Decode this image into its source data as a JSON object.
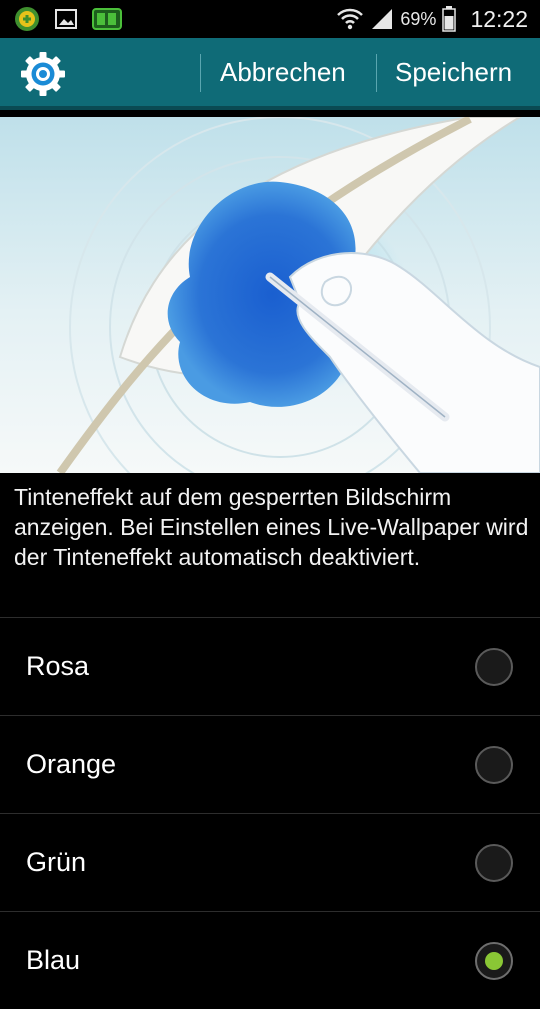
{
  "status_bar": {
    "battery_percent": "69%",
    "time": "12:22",
    "icons": [
      "app-notification-icon",
      "image-notification-icon",
      "game-notification-icon",
      "wifi-icon",
      "signal-icon",
      "battery-icon"
    ]
  },
  "action_bar": {
    "cancel_label": "Abbrechen",
    "save_label": "Speichern",
    "accent_color": "#0f6b77"
  },
  "description": "Tinteneffekt auf dem gesperrten Bildschirm anzeigen. Bei Einstellen eines Live-Wallpaper wird der Tinteneffekt automatisch deaktiviert.",
  "options": [
    {
      "label": "Rosa",
      "selected": false
    },
    {
      "label": "Orange",
      "selected": false
    },
    {
      "label": "Grün",
      "selected": false
    },
    {
      "label": "Blau",
      "selected": true
    }
  ],
  "colors": {
    "selected_radio": "#8ac735"
  }
}
